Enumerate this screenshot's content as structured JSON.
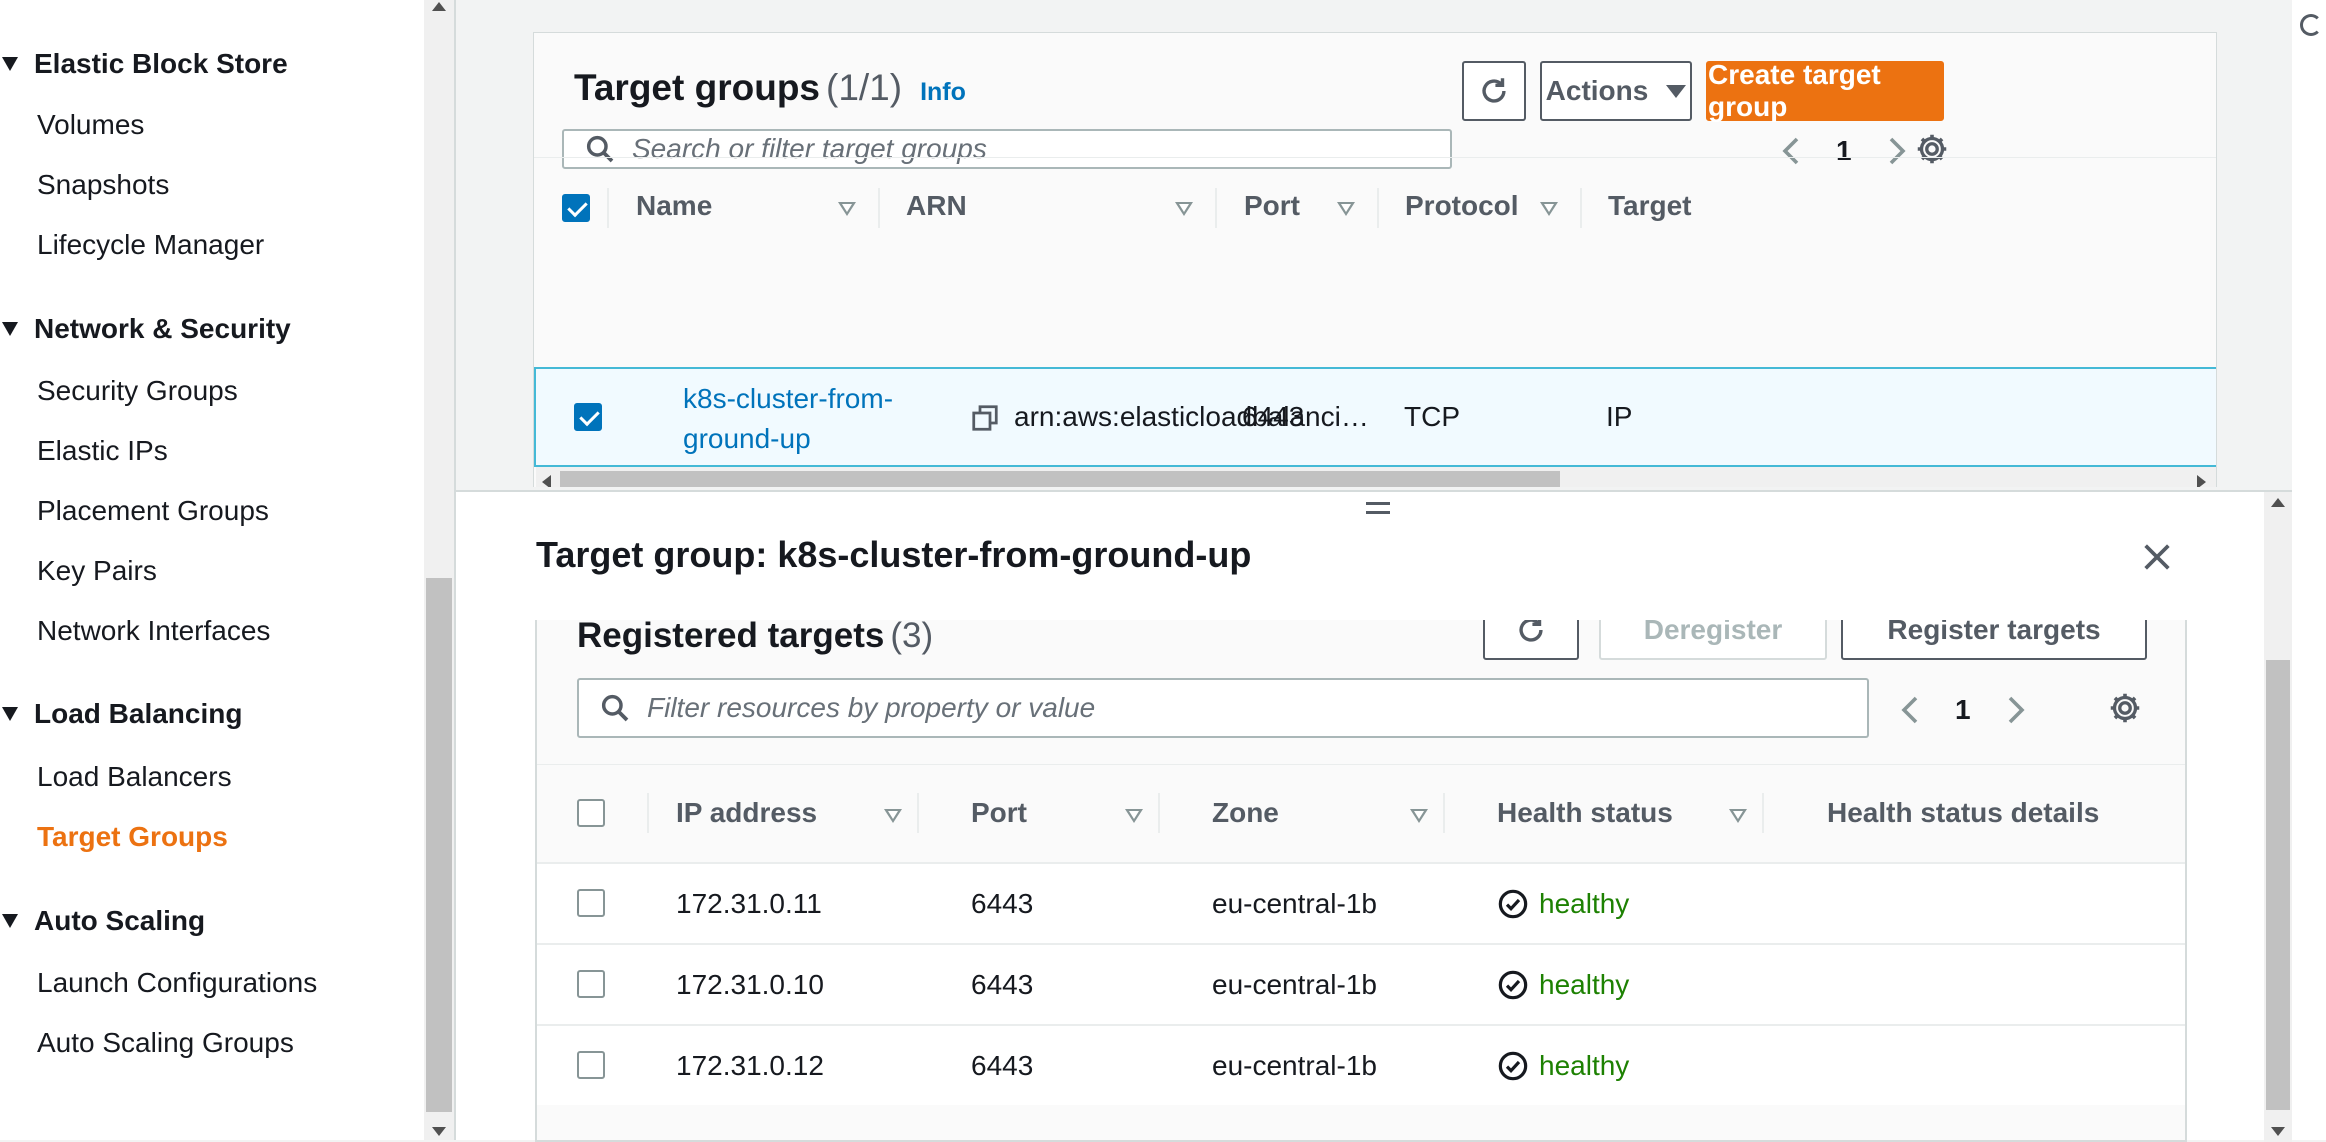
{
  "sidebar": {
    "sections": [
      {
        "label": "Elastic Block Store",
        "items": [
          "Volumes",
          "Snapshots",
          "Lifecycle Manager"
        ]
      },
      {
        "label": "Network & Security",
        "items": [
          "Security Groups",
          "Elastic IPs",
          "Placement Groups",
          "Key Pairs",
          "Network Interfaces"
        ]
      },
      {
        "label": "Load Balancing",
        "items": [
          "Load Balancers",
          "Target Groups"
        ]
      },
      {
        "label": "Auto Scaling",
        "items": [
          "Launch Configurations",
          "Auto Scaling Groups"
        ]
      }
    ],
    "active_item": "Target Groups"
  },
  "target_groups": {
    "title": "Target groups",
    "count": "(1/1)",
    "info_link": "Info",
    "actions_label": "Actions",
    "create_label": "Create target group",
    "search_placeholder": "Search or filter target groups",
    "page": "1",
    "columns": [
      "Name",
      "ARN",
      "Port",
      "Protocol",
      "Target"
    ],
    "row": {
      "name_line1": "k8s-cluster-from-",
      "name_line2": "ground-up",
      "arn": "arn:aws:elasticloadbalanci…",
      "port": "6443",
      "protocol": "TCP",
      "target": "IP"
    }
  },
  "split_panel": {
    "title": "Target group: k8s-cluster-from-ground-up",
    "registered_targets": {
      "title": "Registered targets",
      "count": "(3)",
      "deregister_label": "Deregister",
      "register_label": "Register targets",
      "filter_placeholder": "Filter resources by property or value",
      "page": "1",
      "columns": [
        "IP address",
        "Port",
        "Zone",
        "Health status",
        "Health status details"
      ],
      "rows": [
        {
          "ip": "172.31.0.11",
          "port": "6443",
          "zone": "eu-central-1b",
          "health": "healthy",
          "details": ""
        },
        {
          "ip": "172.31.0.10",
          "port": "6443",
          "zone": "eu-central-1b",
          "health": "healthy",
          "details": ""
        },
        {
          "ip": "172.31.0.12",
          "port": "6443",
          "zone": "eu-central-1b",
          "health": "healthy",
          "details": ""
        }
      ]
    }
  },
  "colors": {
    "accent_orange": "#ec7211",
    "link_blue": "#0073bb",
    "healthy_green": "#1d8102",
    "selected_row_bg": "#f1faff"
  },
  "icons": [
    "refresh-icon",
    "caret-down-icon",
    "search-icon",
    "chevron-left-icon",
    "chevron-right-icon",
    "gear-icon",
    "copy-icon",
    "close-icon",
    "check-circle-icon"
  ]
}
